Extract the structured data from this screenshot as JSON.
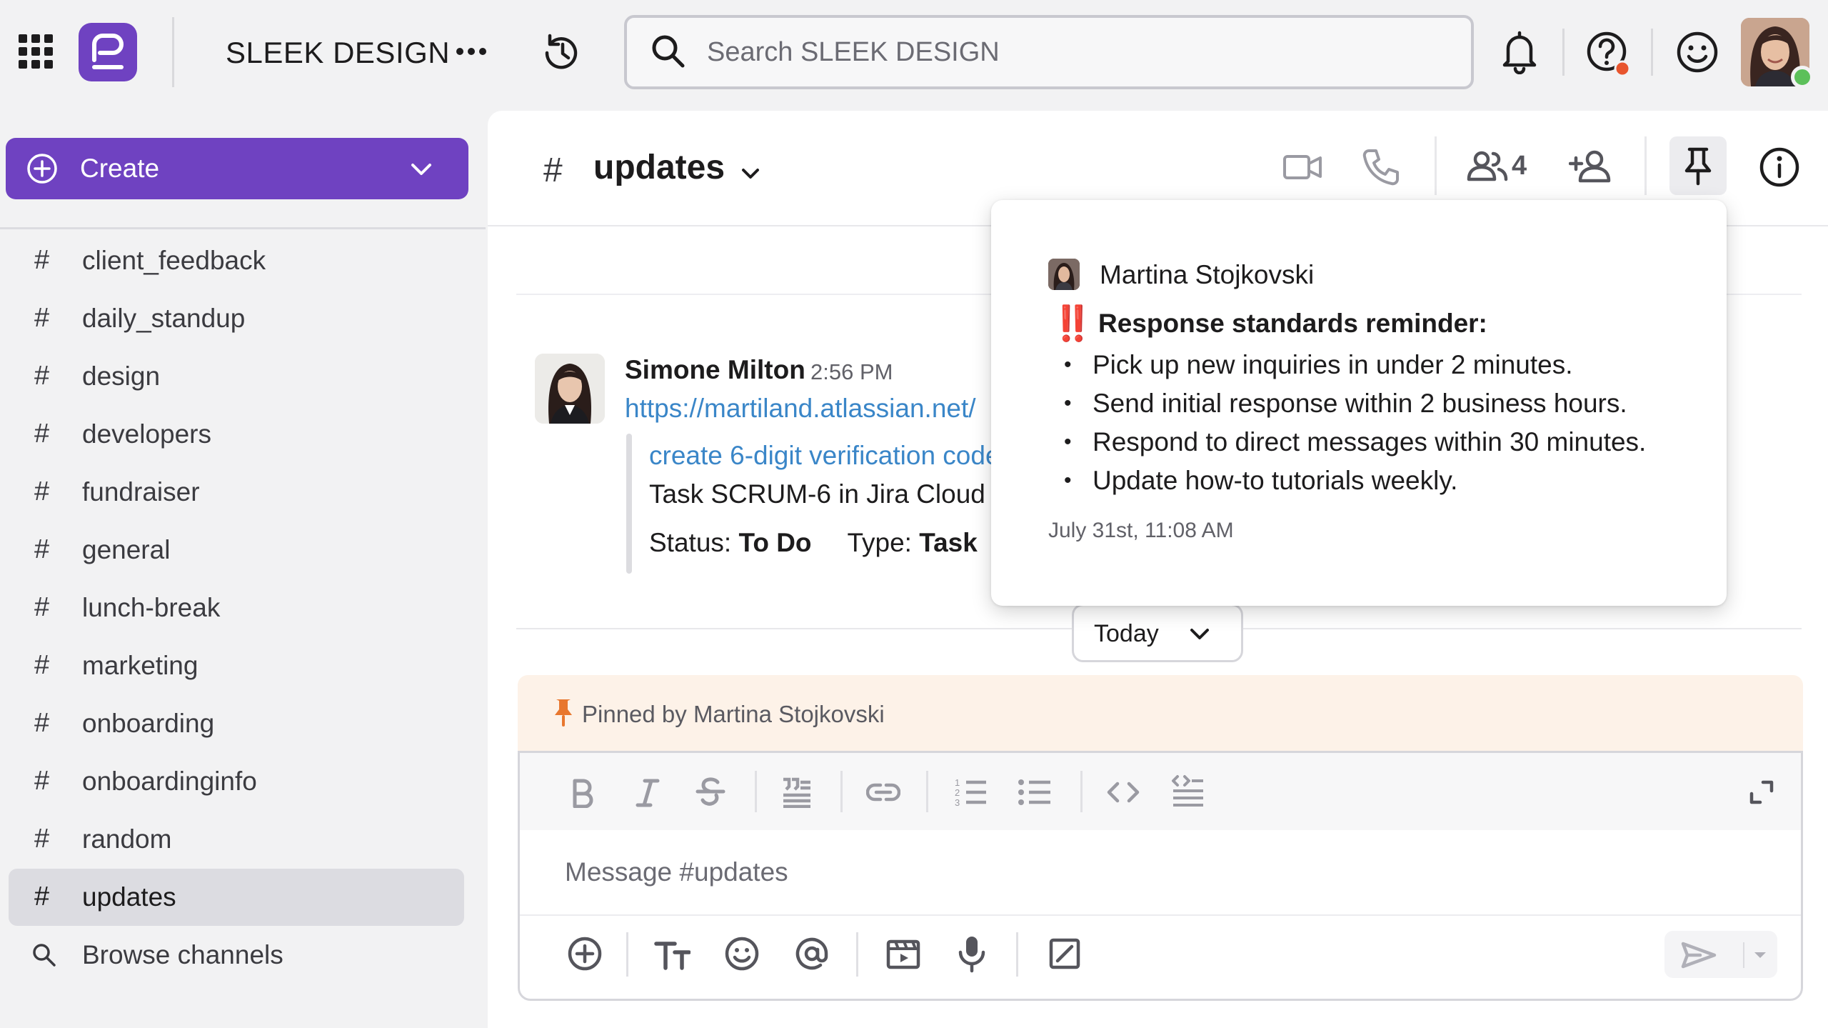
{
  "topbar": {
    "workspace_name": "SLEEK DESIGN",
    "search_placeholder": "Search SLEEK DESIGN"
  },
  "sidebar": {
    "create_label": "Create",
    "channels": [
      {
        "name": "client_feedback"
      },
      {
        "name": "daily_standup"
      },
      {
        "name": "design"
      },
      {
        "name": "developers"
      },
      {
        "name": "fundraiser"
      },
      {
        "name": "general"
      },
      {
        "name": "lunch-break"
      },
      {
        "name": "marketing"
      },
      {
        "name": "onboarding"
      },
      {
        "name": "onboardinginfo"
      },
      {
        "name": "random"
      },
      {
        "name": "updates",
        "active": true
      }
    ],
    "browse_label": "Browse channels",
    "hash": "#"
  },
  "channel": {
    "name": "updates",
    "member_count": "4"
  },
  "message": {
    "author": "Simone Milton",
    "time": "2:56 PM",
    "link": "https://martiland.atlassian.net/",
    "attachment_title": "create 6-digit verification code",
    "attachment_subtitle": "Task SCRUM-6 in Jira Cloud",
    "status_label": "Status:",
    "status_value": "To Do",
    "type_label": "Type:",
    "type_value": "Task"
  },
  "divider": {
    "today_label": "Today"
  },
  "pinned": {
    "text": "Pinned by Martina Stojkovski"
  },
  "composer": {
    "placeholder": "Message #updates"
  },
  "popover": {
    "author": "Martina Stojkovski",
    "emoji": "‼️",
    "title": "Response standards reminder:",
    "items": [
      "Pick up new inquiries in under 2 minutes.",
      "Send initial response within 2 business hours.",
      "Respond to direct messages within 30 minutes.",
      "Update how-to tutorials weekly."
    ],
    "timestamp": "July 31st, 11:08 AM"
  },
  "colors": {
    "brand": "#6f42c1",
    "link": "#3a86c8",
    "pinned_bg": "#fdf2e8",
    "pin_icon": "#e8772e",
    "alert_red": "#e01e2f",
    "online": "#5cc05a",
    "notify_dot": "#e8552e"
  }
}
